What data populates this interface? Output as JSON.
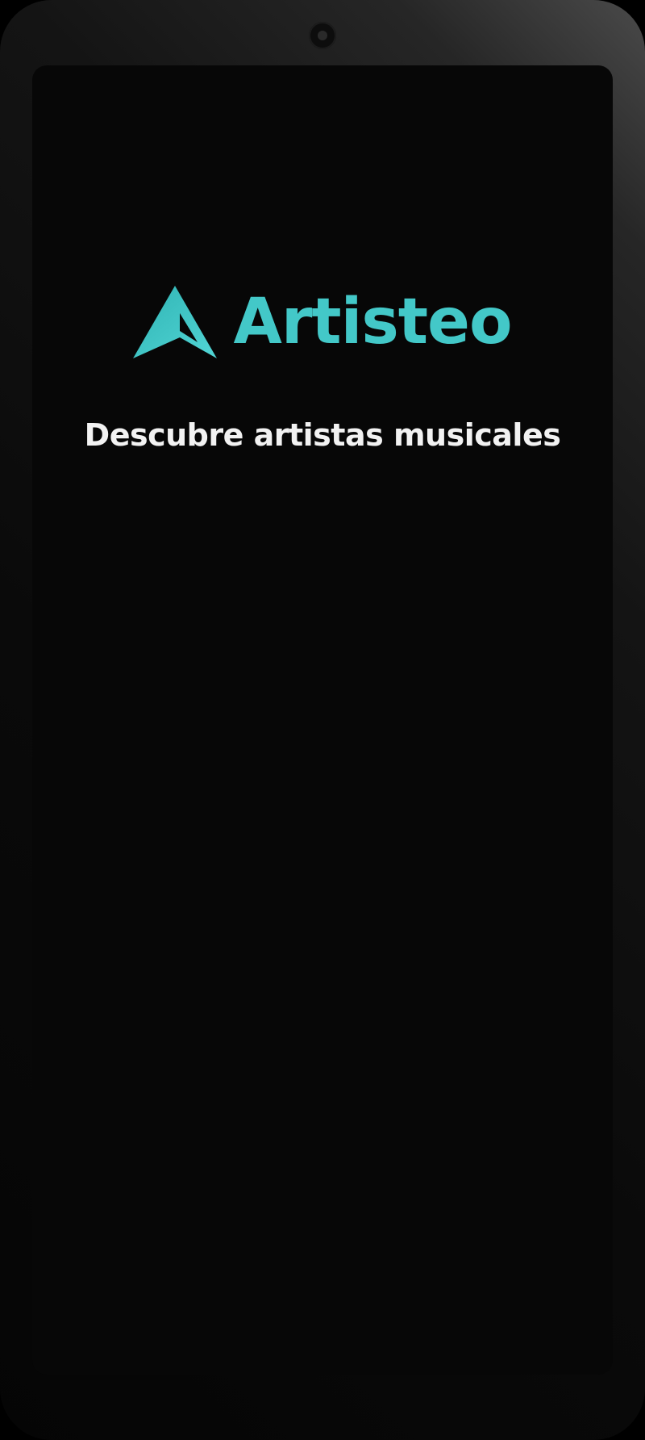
{
  "app": {
    "brand_name": "Artisteo",
    "tagline": "Descubre artistas musicales",
    "logo_icon": "artisteo-logo-icon"
  },
  "colors": {
    "accent": "#43c8c8",
    "background": "#070707",
    "text": "#f2f2f2"
  }
}
